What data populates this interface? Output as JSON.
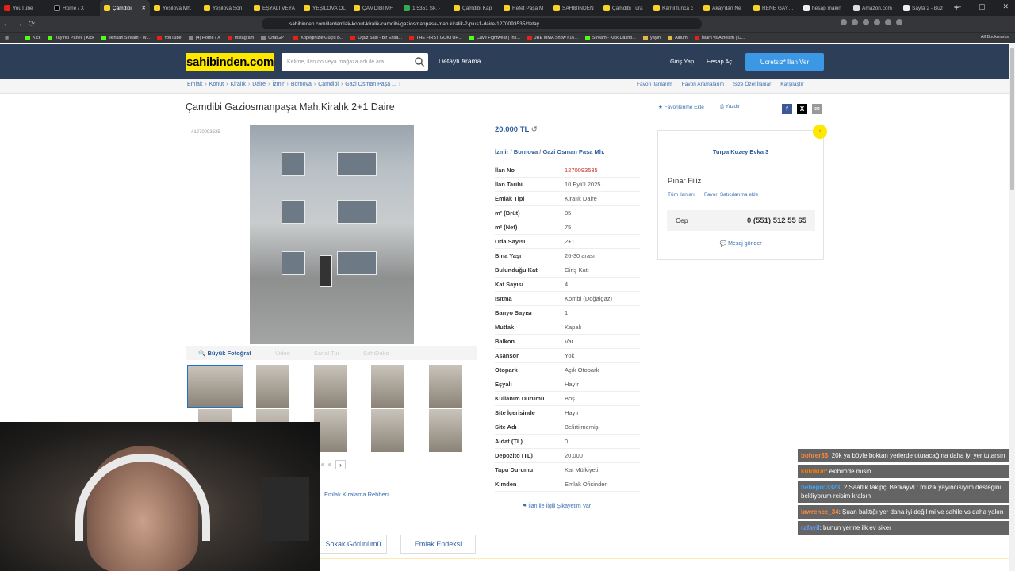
{
  "browser": {
    "tabs": [
      {
        "label": "YouTube",
        "icon": "youtube-icon"
      },
      {
        "label": "Home / X",
        "icon": "x-icon"
      },
      {
        "label": "Çamdibi",
        "icon": "sahibinden-icon",
        "active": true
      },
      {
        "label": "Yeşilova Mh.",
        "icon": "sahibinden-icon"
      },
      {
        "label": "Yeşilova Son",
        "icon": "sahibinden-icon"
      },
      {
        "label": "EŞYALI VEYA",
        "icon": "sahibinden-icon"
      },
      {
        "label": "YEŞİLOVA OL",
        "icon": "sahibinden-icon"
      },
      {
        "label": "ÇAMDİBİ MF",
        "icon": "sahibinden-icon"
      },
      {
        "label": "1 5351 Sk. -",
        "icon": "maps-icon"
      },
      {
        "label": "Çamdibi Kap",
        "icon": "sahibinden-icon"
      },
      {
        "label": "Refet Paşa M",
        "icon": "sahibinden-icon"
      },
      {
        "label": "SAHİBİNDEN",
        "icon": "sahibinden-icon"
      },
      {
        "label": "Çamdibi Tura",
        "icon": "sahibinden-icon"
      },
      {
        "label": "Kamil tunca c",
        "icon": "sahibinden-icon"
      },
      {
        "label": "Akay'dan Ne",
        "icon": "sahibinden-icon"
      },
      {
        "label": "RENE GAYRİM",
        "icon": "sahibinden-icon"
      },
      {
        "label": "hesap makin",
        "icon": "google-icon"
      },
      {
        "label": "Amazon.com",
        "icon": "amazon-icon"
      },
      {
        "label": "Sayfa 2 - Buz",
        "icon": "page-icon"
      }
    ],
    "url": "sahibinden.com/ilan/emlak-konut-kiralik-camdibi-gaziosmanpasa-mah.kiralik-2-plus1-daire-1270093535/detay",
    "bookmarks": [
      "Kick",
      "Yayıncı Paneli | Kick",
      "ilkinsan Stream - W...",
      "YouTube",
      "(4) Home / X",
      "Instagram",
      "ChatGPT",
      "Köpeğinizle Güçlü B...",
      "Oğuz Sasi - Bir Ehsa...",
      "THE FIRST GOKTUR...",
      "Cave Fightwear | Ins...",
      "JRE MMA Show #16...",
      "Stream - Kick Dashb...",
      "yayın",
      "Albüm",
      "İslam vs Atheism | O..."
    ],
    "all_bookmarks": "All Bookmarks"
  },
  "header": {
    "logo": "sahibinden.com",
    "search_placeholder": "Kelime, ilan no veya mağaza adı ile ara",
    "detailed_search": "Detaylı Arama",
    "login": "Giriş Yap",
    "register": "Hesap Aç",
    "post_ad": "Ücretsiz* İlan Ver",
    "brand_color": "#ffe800",
    "header_bg": "#2d3e59"
  },
  "breadcrumb": [
    "Emlak",
    "Konut",
    "Kiralık",
    "Daire",
    "İzmir",
    "Bornova",
    "Çamdibi",
    "Gazi Osman Paşa ..."
  ],
  "right_links": [
    "Favori İlanlarım",
    "Favori Aramalarım",
    "Size Özel İlanlar",
    "Karşılaştır"
  ],
  "listing": {
    "title": "Çamdibi Gaziosmanpaşa Mah.Kiralık 2+1 Daire",
    "ad_no_tag": "#1270093535",
    "add_favorites": "Favorilerime Ekle",
    "print": "Yazdır",
    "price": "20.000 TL",
    "location": [
      "İzmir",
      "Bornova",
      "Gazi Osman Paşa Mh."
    ],
    "attributes": [
      {
        "k": "İlan No",
        "v": "1270093535",
        "red": true
      },
      {
        "k": "İlan Tarihi",
        "v": "10 Eylül 2025"
      },
      {
        "k": "Emlak Tipi",
        "v": "Kiralık Daire"
      },
      {
        "k": "m² (Brüt)",
        "v": "85"
      },
      {
        "k": "m² (Net)",
        "v": "75"
      },
      {
        "k": "Oda Sayısı",
        "v": "2+1"
      },
      {
        "k": "Bina Yaşı",
        "v": "26-30 arası"
      },
      {
        "k": "Bulunduğu Kat",
        "v": "Giriş Katı"
      },
      {
        "k": "Kat Sayısı",
        "v": "4"
      },
      {
        "k": "Isıtma",
        "v": "Kombi (Doğalgaz)"
      },
      {
        "k": "Banyo Sayısı",
        "v": "1"
      },
      {
        "k": "Mutfak",
        "v": "Kapalı"
      },
      {
        "k": "Balkon",
        "v": "Var"
      },
      {
        "k": "Asansör",
        "v": "Yok"
      },
      {
        "k": "Otopark",
        "v": "Açık Otopark"
      },
      {
        "k": "Eşyalı",
        "v": "Hayır"
      },
      {
        "k": "Kullanım Durumu",
        "v": "Boş"
      },
      {
        "k": "Site İçerisinde",
        "v": "Hayır"
      },
      {
        "k": "Site Adı",
        "v": "Belirtilmemiş"
      },
      {
        "k": "Aidat (TL)",
        "v": "0"
      },
      {
        "k": "Depozito (TL)",
        "v": "20.000"
      },
      {
        "k": "Tapu Durumu",
        "v": "Kat Mülkiyeti"
      },
      {
        "k": "Kimden",
        "v": "Emlak Ofisinden"
      }
    ],
    "complain": "İlan ile İlgili Şikayetim Var"
  },
  "media": {
    "big_photo": "Büyük Fotoğraf",
    "video": "Video",
    "virtual_tour": "Sanal Tur",
    "sahideko": "SahiDeko",
    "guide_link": "Emlak Kiralama Rehberi",
    "street_view": "Sokak Görünümü",
    "property_index": "Emlak Endeksi"
  },
  "seller": {
    "store": "Turpa Kuzey Evka 3",
    "agent": "Pınar Filiz",
    "all_ads": "Tüm ilanları",
    "add_fav_seller": "Favori Satıcılarıma ekle",
    "phone_label": "Cep",
    "phone": "0 (551) 512 55 65",
    "send_message": "Mesaj gönder"
  },
  "chat": [
    {
      "user": "bohrer33",
      "text": "20k ya böyle boktan yerlerde oturacağına daha iyi yer tutarsın"
    },
    {
      "user": "kutokun",
      "text": "ekibimde misin"
    },
    {
      "user": "bebepro3323",
      "text": "2 Saatlik takipçi BerkayVl : müzik yayıncısıyım desteğini bekliyorum reisim kralsın"
    },
    {
      "user": "lawrence_34",
      "text": "Şuan baktığı yer daha iyi değil mi ve sahile vs daha yakın"
    },
    {
      "user": "rafayil",
      "text": "bunun yerine ilk ev siker"
    }
  ]
}
